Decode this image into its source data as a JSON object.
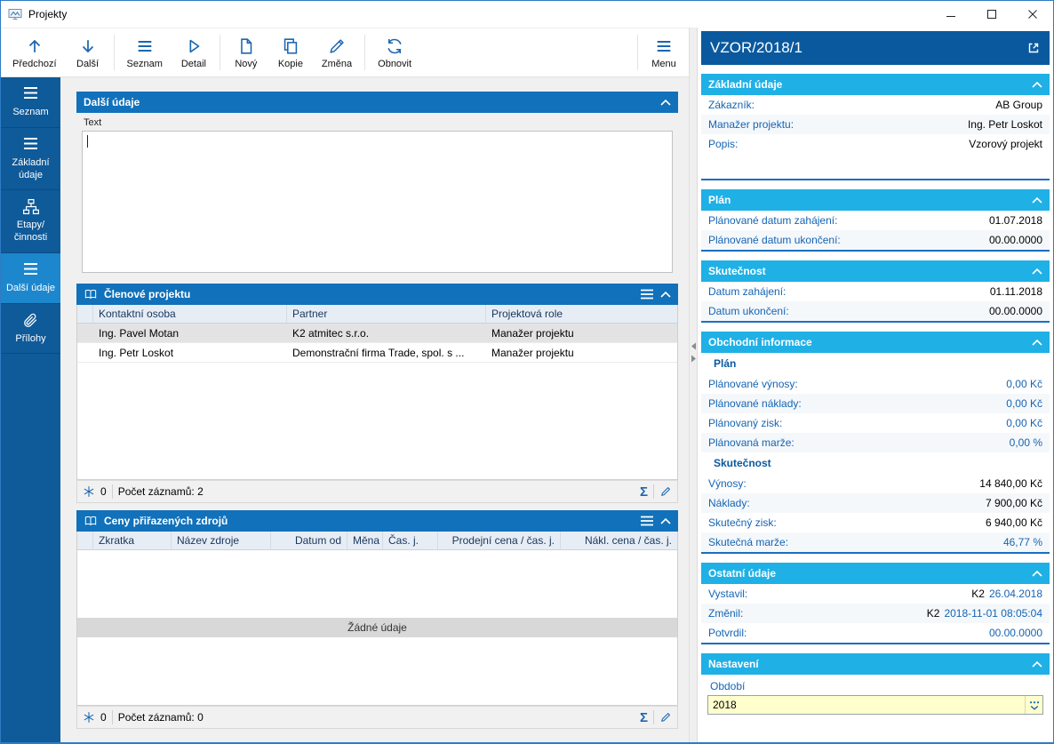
{
  "colors": {
    "window_border": "#2E7CC4",
    "sidebar_bg": "#0F5A99",
    "sidebar_selected_bg": "#1C87CD",
    "panel_header_bg": "#1171BA",
    "detail_header_bg": "#0A599E",
    "section_header_bg": "#1FB0E6",
    "section_divider": "#1A6FC0",
    "label_blue": "#1464B4",
    "toolbar_icon_blue": "#1B66B0",
    "highlight_yellow": "#FFFFCE",
    "selected_row_gray": "#E3E3E3"
  },
  "icons": {
    "app-icon": "chart-image",
    "minimize-icon": "–",
    "maximize-icon": "▢",
    "close-icon": "✕",
    "arrow-up-icon": "↑",
    "arrow-down-icon": "↓",
    "list-icon": "☰",
    "detail-icon": "▷",
    "new-doc-icon": "document",
    "copy-icon": "two-documents",
    "pencil-icon": "✎",
    "refresh-icon": "circular-arrows",
    "menu-icon": "☰",
    "hierarchy-icon": "org-chart",
    "paperclip-icon": "paperclip",
    "book-icon": "open-book",
    "collapse-icon": "chevron-up",
    "expand-icon": "open-in-window",
    "snowflake-icon": "❄",
    "sigma-icon": "Σ",
    "combo-icon": "dots-chevron"
  },
  "window": {
    "title": "Projekty"
  },
  "toolbar": {
    "buttons": [
      {
        "label": "Předchozí",
        "icon": "arrow-up-icon"
      },
      {
        "label": "Další",
        "icon": "arrow-down-icon"
      },
      {
        "label": "Seznam",
        "icon": "list-icon"
      },
      {
        "label": "Detail",
        "icon": "detail-icon"
      },
      {
        "label": "Nový",
        "icon": "new-doc-icon"
      },
      {
        "label": "Kopie",
        "icon": "copy-icon"
      },
      {
        "label": "Změna",
        "icon": "pencil-icon"
      },
      {
        "label": "Obnovit",
        "icon": "refresh-icon"
      }
    ],
    "menu": {
      "label": "Menu",
      "icon": "menu-icon"
    }
  },
  "sidebar": {
    "items": [
      {
        "label": "Seznam",
        "icon": "list-icon",
        "selected": false
      },
      {
        "label": "Základní údaje",
        "icon": "list-icon",
        "selected": false
      },
      {
        "label": "Etapy/\nčinnosti",
        "icon": "hierarchy-icon",
        "selected": false
      },
      {
        "label": "Další údaje",
        "icon": "list-icon",
        "selected": true
      },
      {
        "label": "Přílohy",
        "icon": "paperclip-icon",
        "selected": false
      }
    ]
  },
  "panels": {
    "notes": {
      "title": "Další údaje",
      "text_label": "Text",
      "text_value": ""
    },
    "members": {
      "title": "Členové projektu",
      "columns": [
        "Kontaktní osoba",
        "Partner",
        "Projektová role"
      ],
      "rows": [
        [
          "Ing. Pavel Motan",
          "K2 atmitec s.r.o.",
          "Manažer projektu"
        ],
        [
          "Ing. Petr Loskot",
          "Demonstrační firma Trade, spol. s ...",
          "Manažer projektu"
        ]
      ],
      "footer": {
        "flake": "0",
        "records": "Počet záznamů: 2"
      }
    },
    "prices": {
      "title": "Ceny přiřazených zdrojů",
      "columns": [
        "Zkratka",
        "Název zdroje",
        "Datum od",
        "Měna",
        "Čas. j.",
        "Prodejní cena / čas. j.",
        "Nákl. cena / čas. j."
      ],
      "empty": "Žádné údaje",
      "footer": {
        "flake": "0",
        "records": "Počet záznamů: 0"
      }
    }
  },
  "detail": {
    "title": "VZOR/2018/1",
    "zakladni": {
      "title": "Základní údaje",
      "rows": [
        {
          "label": "Zákazník:",
          "value": "AB Group"
        },
        {
          "label": "Manažer projektu:",
          "value": "Ing. Petr Loskot"
        },
        {
          "label": "Popis:",
          "value": "Vzorový projekt"
        }
      ]
    },
    "plan": {
      "title": "Plán",
      "rows": [
        {
          "label": "Plánované datum zahájení:",
          "value": "01.07.2018"
        },
        {
          "label": "Plánované datum ukončení:",
          "value": "00.00.0000"
        }
      ]
    },
    "skutecnost": {
      "title": "Skutečnost",
      "rows": [
        {
          "label": "Datum zahájení:",
          "value": "01.11.2018"
        },
        {
          "label": "Datum ukončení:",
          "value": "00.00.0000"
        }
      ]
    },
    "obchodni": {
      "title": "Obchodní informace",
      "plan": {
        "subtitle": "Plán",
        "rows": [
          {
            "label": "Plánované výnosy:",
            "value": "0,00 Kč"
          },
          {
            "label": "Plánované náklady:",
            "value": "0,00 Kč"
          },
          {
            "label": "Plánovaný zisk:",
            "value": "0,00 Kč"
          },
          {
            "label": "Plánovaná marže:",
            "value": "0,00 %"
          }
        ]
      },
      "skut": {
        "subtitle": "Skutečnost",
        "rows": [
          {
            "label": "Výnosy:",
            "value": "14 840,00 Kč"
          },
          {
            "label": "Náklady:",
            "value": "7 900,00 Kč"
          },
          {
            "label": "Skutečný zisk:",
            "value": "6 940,00 Kč"
          },
          {
            "label": "Skutečná marže:",
            "value": "46,77 %"
          }
        ]
      }
    },
    "ostatni": {
      "title": "Ostatní údaje",
      "rows": [
        {
          "label": "Vystavil:",
          "text": "K2",
          "link": "26.04.2018"
        },
        {
          "label": "Změnil:",
          "text": "K2",
          "link": "2018-11-01 08:05:04"
        },
        {
          "label": "Potvrdil:",
          "text": "",
          "link": "00.00.0000"
        }
      ]
    },
    "nastaveni": {
      "title": "Nastavení",
      "field_label": "Období",
      "field_value": "2018"
    }
  }
}
